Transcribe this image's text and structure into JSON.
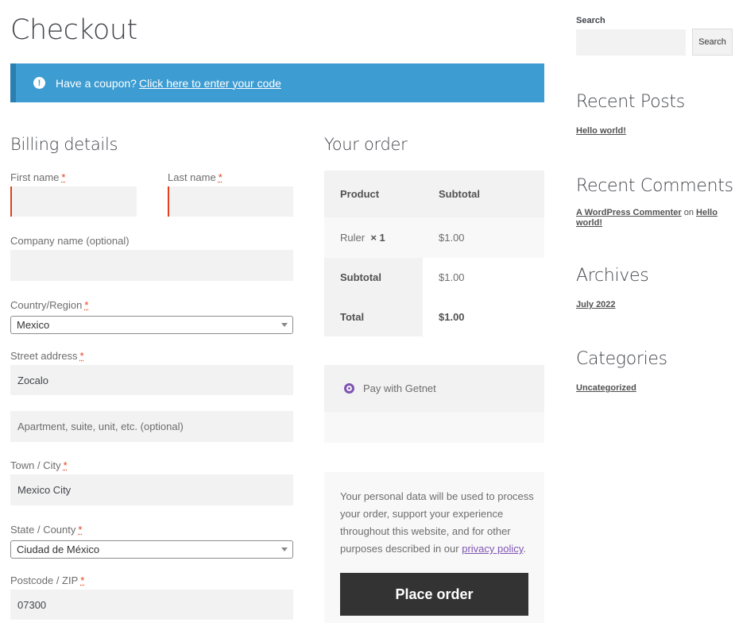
{
  "page": {
    "title": "Checkout"
  },
  "notice": {
    "text": "Have a coupon?",
    "link": "Click here to enter your code"
  },
  "billing": {
    "heading": "Billing details",
    "first_name_label": "First name",
    "last_name_label": "Last name",
    "company_label": "Company name (optional)",
    "country_label": "Country/Region",
    "country_value": "Mexico",
    "street_label": "Street address",
    "street_value": "Zocalo",
    "apartment_placeholder": "Apartment, suite, unit, etc. (optional)",
    "city_label": "Town / City",
    "city_value": "Mexico City",
    "state_label": "State / County",
    "state_value": "Ciudad de México",
    "postcode_label": "Postcode / ZIP",
    "postcode_value": "07300",
    "required_mark": "*"
  },
  "order": {
    "heading": "Your order",
    "col_product": "Product",
    "col_subtotal": "Subtotal",
    "item_name": "Ruler",
    "item_qty": "× 1",
    "item_price": "$1.00",
    "subtotal_label": "Subtotal",
    "subtotal_value": "$1.00",
    "total_label": "Total",
    "total_value": "$1.00"
  },
  "payment": {
    "method": "Pay with Getnet"
  },
  "privacy": {
    "text": "Your personal data will be used to process your order, support your experience throughout this website, and for other purposes described in our",
    "link": "privacy policy",
    "end": "."
  },
  "place_order": {
    "label": "Place order"
  },
  "sidebar": {
    "search_label": "Search",
    "search_button": "Search",
    "recent_posts_title": "Recent Posts",
    "recent_post_1": "Hello world!",
    "recent_comments_title": "Recent Comments",
    "comment_author": "A WordPress Commenter",
    "comment_on": "on",
    "comment_post": "Hello world!",
    "archives_title": "Archives",
    "archive_1": "July 2022",
    "categories_title": "Categories",
    "category_1": "Uncategorized"
  },
  "colors": {
    "notice_bg": "#3d9cd2",
    "button_bg": "#333333",
    "accent": "#7f54b3",
    "required": "#e2401c"
  }
}
